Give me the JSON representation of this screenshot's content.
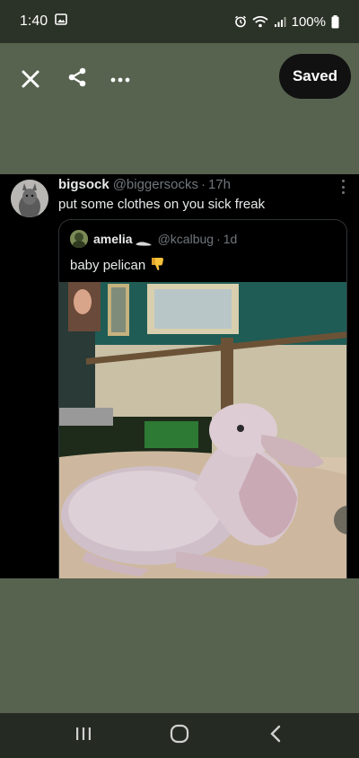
{
  "status_bar": {
    "time": "1:40",
    "battery": "100%",
    "icons": [
      "image-icon",
      "alarm-icon",
      "wifi-icon",
      "signal-icon",
      "battery-icon"
    ]
  },
  "viewer": {
    "close_icon": "close-icon",
    "share_icon": "share-icon",
    "more_icon": "more-icon",
    "saved_label": "Saved"
  },
  "tweet": {
    "display_name": "bigsock",
    "handle": "@biggersocks",
    "time": "17h",
    "text": "put some clothes on you sick freak",
    "quote": {
      "display_name": "amelia",
      "handle": "@kcalbug",
      "time": "1d",
      "text": "baby pelican"
    }
  },
  "nav_bar": {
    "icons": [
      "recent-apps-icon",
      "home-icon",
      "back-icon"
    ]
  },
  "colors": {
    "background": "#56624f",
    "tweet_bg": "#000000",
    "muted_text": "#71767b",
    "primary_text": "#e7e9ea"
  }
}
